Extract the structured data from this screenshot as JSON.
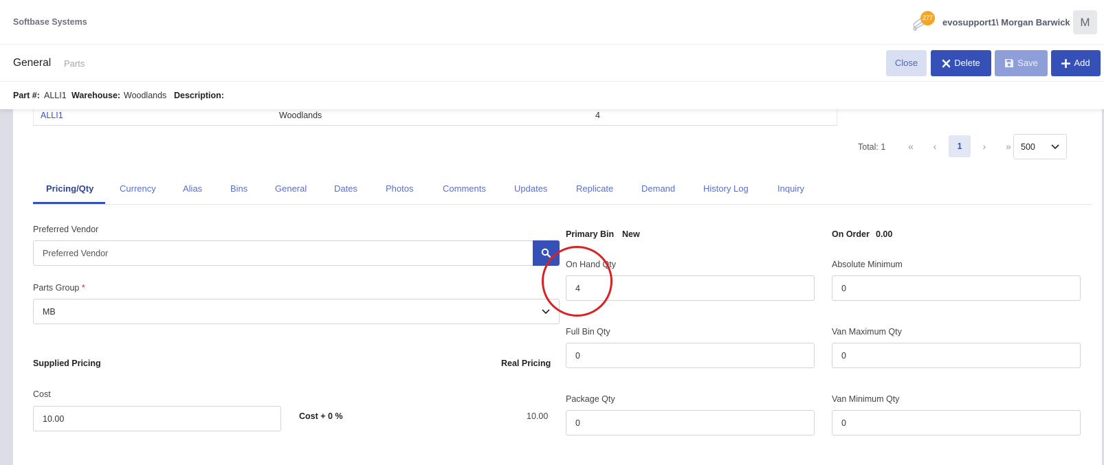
{
  "app": {
    "brand": "Softbase Systems",
    "notification_count": "277",
    "user": "evosupport1\\ Morgan Barwick",
    "avatar_initial": "M"
  },
  "header": {
    "breadcrumb_current": "General",
    "breadcrumb_next": "Parts",
    "buttons": {
      "close": "Close",
      "delete": "Delete",
      "save": "Save",
      "add": "Add"
    }
  },
  "infobar": {
    "part_label": "Part #:",
    "part_value": "ALLI1",
    "warehouse_label": "Warehouse:",
    "warehouse_value": "Woodlands",
    "description_label": "Description:",
    "description_value": ""
  },
  "grid": {
    "row": {
      "part": "ALLI1",
      "warehouse": "Woodlands",
      "qty": "4"
    }
  },
  "pager": {
    "total": "Total: 1",
    "first": "«",
    "prev": "‹",
    "page": "1",
    "next": "›",
    "last": "»",
    "page_size": "500"
  },
  "tabs": [
    "Pricing/Qty",
    "Currency",
    "Alias",
    "Bins",
    "General",
    "Dates",
    "Photos",
    "Comments",
    "Updates",
    "Replicate",
    "Demand",
    "History Log",
    "Inquiry"
  ],
  "form": {
    "preferred_vendor_label": "Preferred Vendor",
    "preferred_vendor_placeholder": "Preferred Vendor",
    "parts_group_label": "Parts Group",
    "parts_group_required": "*",
    "parts_group_value": "MB",
    "supplied_pricing": "Supplied Pricing",
    "real_pricing": "Real Pricing",
    "cost_label": "Cost",
    "cost_value": "10.00",
    "cost_formula": "Cost + 0 %",
    "real_price_value": "10.00",
    "primary_bin_label": "Primary Bin",
    "primary_bin_value": "New",
    "on_order_label": "On Order",
    "on_order_value": "0.00",
    "on_hand_label": "On Hand Qty",
    "on_hand_value": "4",
    "abs_min_label": "Absolute Minimum",
    "abs_min_value": "0",
    "full_bin_label": "Full Bin Qty",
    "full_bin_value": "0",
    "van_max_label": "Van Maximum Qty",
    "van_max_value": "0",
    "package_label": "Package Qty",
    "package_value": "0",
    "van_min_label": "Van Minimum Qty",
    "van_min_value": "0"
  },
  "colors": {
    "primary": "#3551b8",
    "accent_badge": "#f5a623",
    "annotation": "#d72323"
  }
}
